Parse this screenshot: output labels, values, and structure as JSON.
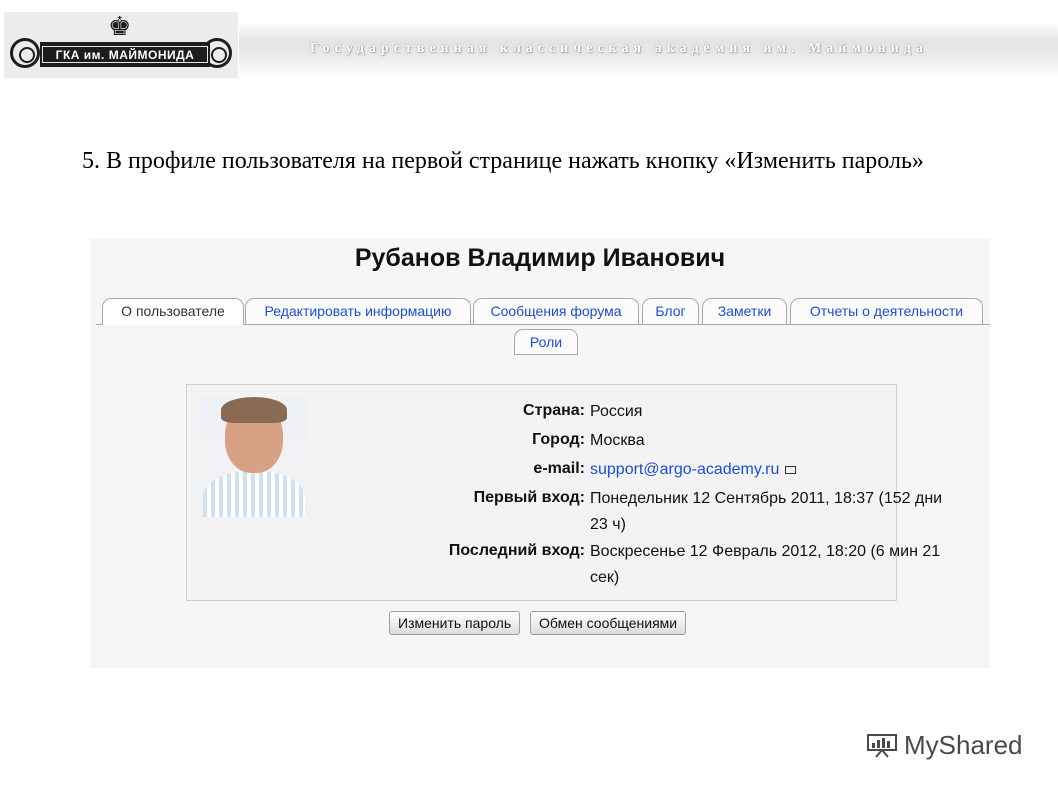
{
  "header": {
    "logo_text": "ГКА им. МАЙМОНИДА",
    "title": "Государственная   классическая академия им. Маймонида"
  },
  "instruction": "5. В профиле пользователя на первой странице нажать кнопку «Изменить пароль»",
  "profile": {
    "user_name": "Рубанов Владимир Иванович",
    "tabs": [
      {
        "label": "О пользователе",
        "active": true
      },
      {
        "label": "Редактировать информацию"
      },
      {
        "label": "Сообщения форума"
      },
      {
        "label": "Блог"
      },
      {
        "label": "Заметки"
      },
      {
        "label": "Отчеты о деятельности"
      },
      {
        "label": "Роли"
      }
    ],
    "fields": [
      {
        "label": "Страна:",
        "value": "Россия"
      },
      {
        "label": "Город:",
        "value": "Москва"
      },
      {
        "label": "e-mail:",
        "value": "support@argo-academy.ru"
      },
      {
        "label": "Первый вход:",
        "value": "Понедельник 12 Сентябрь 2011, 18:37  (152 дни 23 ч)"
      },
      {
        "label": "Последний вход:",
        "value": "Воскресенье 12 Февраль 2012, 18:20  (6 мин 21 сек)"
      }
    ],
    "buttons": {
      "change_password": "Изменить пароль",
      "messaging": "Обмен сообщениями"
    }
  },
  "watermark": "MyShared",
  "colors": {
    "link": "#1b4fd6",
    "panel_bg": "#f6f6f6"
  }
}
